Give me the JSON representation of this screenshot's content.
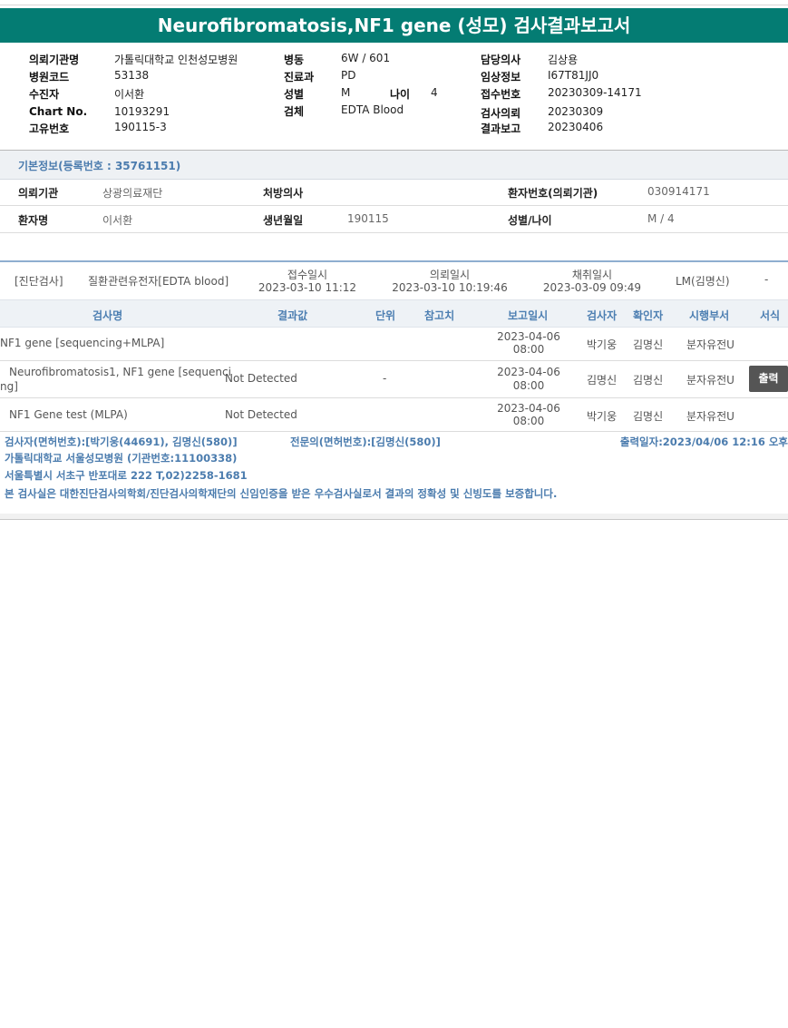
{
  "report": {
    "title": "Neurofibromatosis,NF1 gene (성모) 검사결과보고서"
  },
  "header": {
    "col1": [
      {
        "label": "의뢰기관명",
        "value": "가톨릭대학교 인천성모병원"
      },
      {
        "label": "병원코드",
        "value": "53138"
      },
      {
        "label": "수진자",
        "value": "이서환"
      },
      {
        "label": "Chart No.",
        "value": "10193291"
      },
      {
        "label": "고유번호",
        "value": "190115-3"
      }
    ],
    "col2": [
      {
        "label": "병동",
        "value": "6W / 601"
      },
      {
        "label": "진료과",
        "value": "PD"
      },
      {
        "label": "성별",
        "value": "M"
      },
      {
        "label": "검체",
        "value": "EDTA Blood"
      }
    ],
    "age": {
      "label": "나이",
      "value": "4"
    },
    "col3": [
      {
        "label": "담당의사",
        "value": "김상용"
      },
      {
        "label": "임상정보",
        "value": "I67T81JJ0"
      },
      {
        "label": "접수번호",
        "value": "20230309-14171"
      },
      {
        "label": "검사의뢰",
        "value": "20230309"
      },
      {
        "label": "결과보고",
        "value": "20230406"
      }
    ]
  },
  "basic_info": {
    "title": "기본정보(등록번호 : 35761151)",
    "row1": [
      {
        "label": "의뢰기관",
        "value": "상광의료재단"
      },
      {
        "label": "처방의사",
        "value": ""
      },
      {
        "label": "환자번호(의뢰기관)",
        "value": "030914171"
      }
    ],
    "row2": [
      {
        "label": "환자명",
        "value": "이서환"
      },
      {
        "label": "생년월일",
        "value": "190115"
      },
      {
        "label": "성별/나이",
        "value": "M / 4"
      }
    ]
  },
  "summary": {
    "category": "[진단검사]",
    "test_name": "질환관련유전자[EDTA blood]",
    "received": {
      "label": "접수일시",
      "value": "2023-03-10 11:12"
    },
    "requested": {
      "label": "의뢰일시",
      "value": "2023-03-10 10:19:46"
    },
    "collected": {
      "label": "채취일시",
      "value": "2023-03-09 09:49"
    },
    "lab": "LM(김명신)",
    "dash": "-"
  },
  "table": {
    "headers": [
      "검사명",
      "결과값",
      "단위",
      "참고치",
      "보고일시",
      "검사자",
      "확인자",
      "시행부서",
      "서식"
    ],
    "rows": [
      {
        "name1": "NF1 gene [sequencing+MLPA]",
        "name2": "",
        "result": "",
        "unit": "",
        "report_date": "2023-04-06",
        "report_time": "08:00",
        "tester": "박기웅",
        "confirmer": "김명신",
        "dept": "분자유전U"
      },
      {
        "name1": "Neurofibromatosis1, NF1 gene [sequenci",
        "name2": "ng]",
        "result": "Not Detected",
        "unit": "-",
        "report_date": "2023-04-06",
        "report_time": "08:00",
        "tester": "김명신",
        "confirmer": "김명신",
        "dept": "분자유전U",
        "action": "출력"
      },
      {
        "name1": "NF1 Gene test (MLPA)",
        "name2": "",
        "result": "Not Detected",
        "unit": "",
        "report_date": "2023-04-06",
        "report_time": "08:00",
        "tester": "박기웅",
        "confirmer": "김명신",
        "dept": "분자유전U"
      }
    ]
  },
  "footer": {
    "testers": "검사자(면허번호):[박기웅(44691), 김명신(580)]",
    "specialist": "전문의(면허번호):[김명신(580)]",
    "printed": "출력일자:2023/04/06 12:16 오후",
    "hospital": "가톨릭대학교 서울성모병원 (기관번호:11100338)",
    "address": "서울특별시 서초구 반포대로 222 T,02)2258-1681",
    "certification": "본 검사실은 대한진단검사의학회/진단검사의학재단의 신임인증을 받은 우수검사실로서 결과의 정확성 및 신빙도를 보증합니다."
  }
}
